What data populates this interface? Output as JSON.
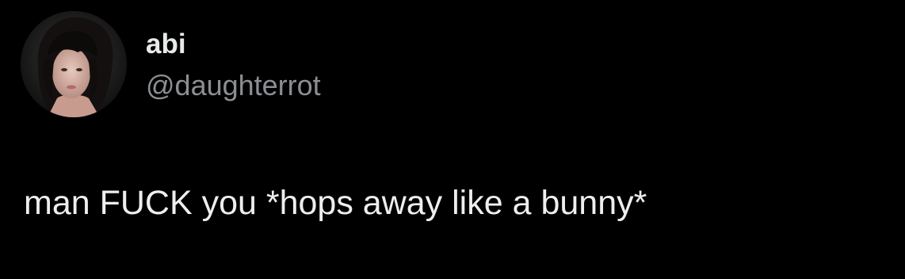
{
  "tweet": {
    "author": {
      "display_name": "abi",
      "handle": "@daughterrot",
      "avatar": "profile-photo"
    },
    "text": "man FUCK you *hops away like a bunny*"
  },
  "colors": {
    "background": "#000000",
    "primary_text": "#e7e9ea",
    "secondary_text": "#8b8f94"
  }
}
